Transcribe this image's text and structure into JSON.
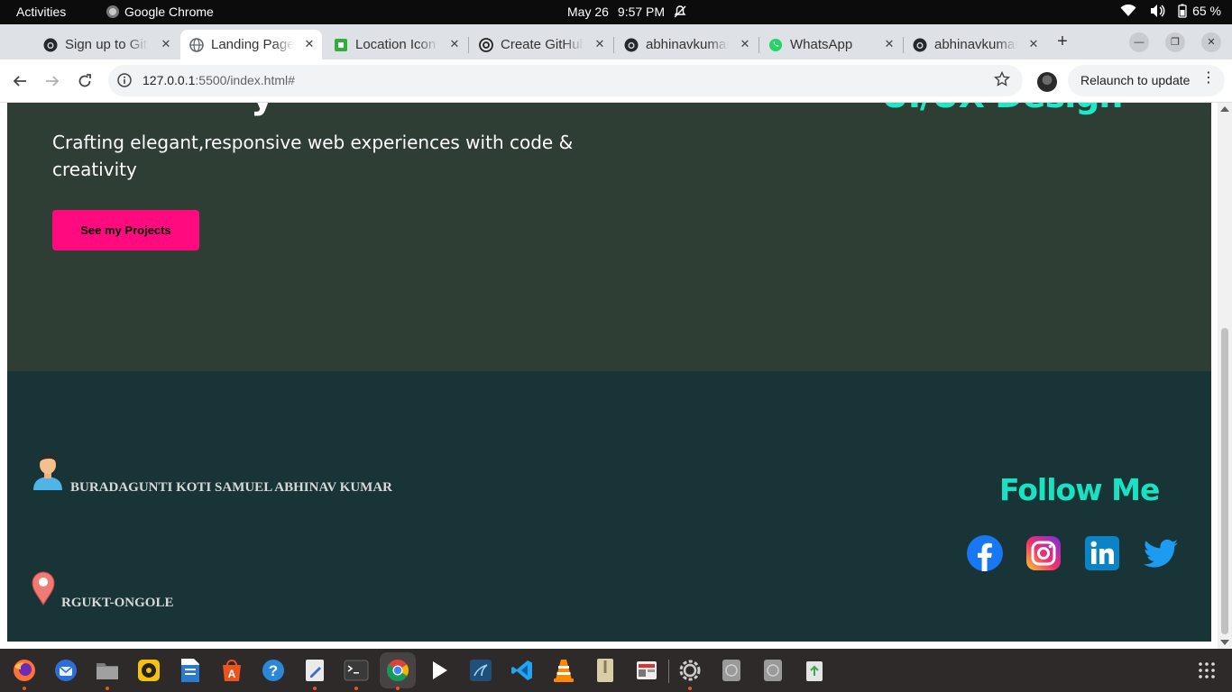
{
  "topbar": {
    "activities": "Activities",
    "app_name": "Google Chrome",
    "date": "May 26",
    "time": "9:57 PM",
    "battery": "65 %"
  },
  "tabs": [
    {
      "title": "Sign up to GitHub",
      "icon": "github-icon",
      "active": false
    },
    {
      "title": "Landing Page",
      "icon": "globe-icon",
      "active": true
    },
    {
      "title": "Location Icon",
      "icon": "green-square-icon",
      "active": false
    },
    {
      "title": "Create GitHub",
      "icon": "openai-icon",
      "active": false
    },
    {
      "title": "abhinavkumar",
      "icon": "github-icon",
      "active": false
    },
    {
      "title": "WhatsApp",
      "icon": "whatsapp-icon",
      "active": false
    },
    {
      "title": "abhinavkumar",
      "icon": "github-icon",
      "active": false
    }
  ],
  "addressbar": {
    "host": "127.0.0.1",
    "path": ":5500/index.html#",
    "relaunch": "Relaunch to update"
  },
  "page": {
    "hero": {
      "cut_heading": "y",
      "rotator_text": "UI/UX Design",
      "tagline": "Crafting elegant,responsive web experiences with code & creativity",
      "cta": "See my Projects"
    },
    "footer": {
      "name": "BURADAGUNTI KOTI SAMUEL ABHINAV KUMAR",
      "location": "RGUKT-ONGOLE",
      "follow": "Follow Me",
      "socials": [
        "facebook",
        "instagram",
        "linkedin",
        "twitter"
      ]
    }
  },
  "colors": {
    "hero_bg": "#2f3e35",
    "footer_bg": "#193436",
    "accent_teal": "#19e2c2",
    "cta_pink": "#ff0a7f"
  },
  "dock": [
    "firefox",
    "thunderbird",
    "files",
    "rhythmbox",
    "writer",
    "app-center",
    "help",
    "text-editor",
    "terminal",
    "chrome",
    "media-player",
    "mysql-workbench",
    "vscode",
    "vlc",
    "archive",
    "screenshot",
    "settings",
    "disk-1",
    "disk-2",
    "trash"
  ]
}
